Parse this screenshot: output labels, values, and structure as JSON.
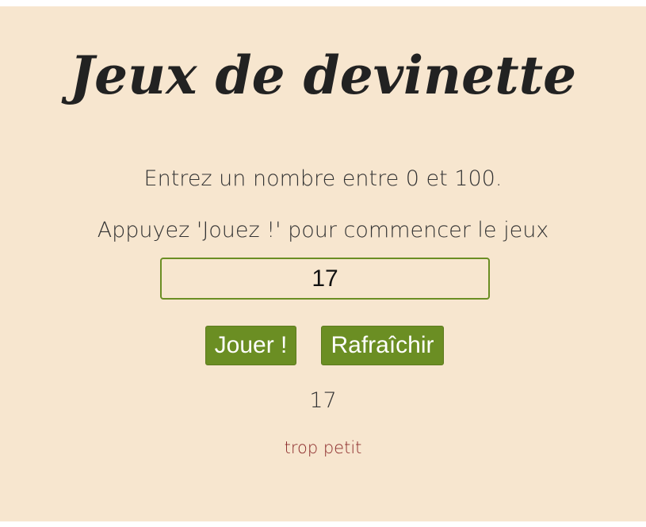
{
  "app": {
    "title": "Jeux de devinette"
  },
  "instructions": {
    "line1": "Entrez un nombre entre 0 et 100.",
    "line2": "Appuyez 'Jouez !' pour commencer le jeux"
  },
  "input": {
    "value": "17",
    "placeholder": ""
  },
  "buttons": {
    "play_label": "Jouer !",
    "refresh_label": "Rafraîchir"
  },
  "result": {
    "last_guess": "17",
    "feedback": "trop petit"
  },
  "colors": {
    "background": "#f7e6cf",
    "accent": "#6b8e23",
    "text": "#333333",
    "feedback": "#8b2a2a"
  }
}
